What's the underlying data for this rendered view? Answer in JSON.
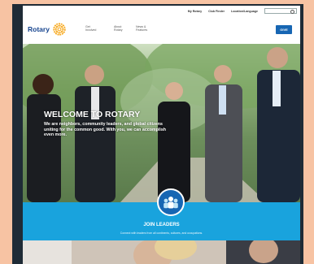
{
  "utility": {
    "links": [
      "My Rotary",
      "Club Finder",
      "Location/Language"
    ],
    "search_placeholder": ""
  },
  "header": {
    "logo": "Rotary",
    "nav": [
      {
        "line1": "Get",
        "line2": "Involved"
      },
      {
        "line1": "About",
        "line2": "Rotary"
      },
      {
        "line1": "News &",
        "line2": "Features"
      }
    ],
    "give_label": "GIVE"
  },
  "hero": {
    "title": "WELCOME TO ROTARY",
    "text": "We are neighbors, community leaders, and global citizens uniting for the common good. With you, we can accomplish even more."
  },
  "join": {
    "title": "JOIN LEADERS",
    "subtitle": "Connect with leaders from all continents, cultures, and occupations."
  },
  "colors": {
    "brand_blue": "#17458f",
    "give_blue": "#1766b3",
    "band_cyan": "#19a3dd",
    "wheel_gold": "#f7a81b"
  }
}
